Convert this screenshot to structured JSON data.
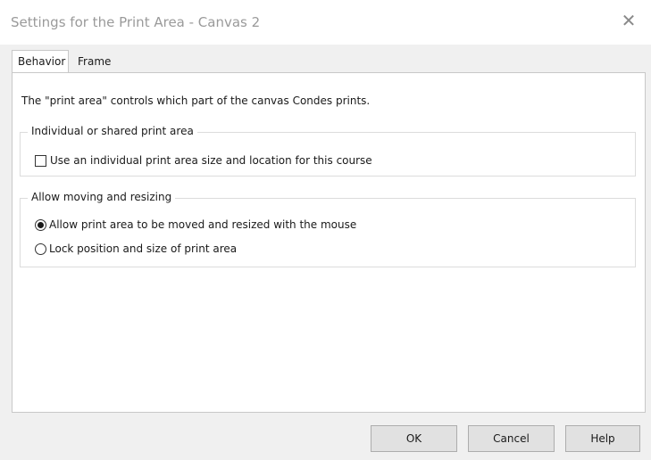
{
  "window": {
    "title": "Settings for the Print Area - Canvas 2",
    "close_glyph": "✕"
  },
  "tabs": [
    {
      "label": "Behavior",
      "active": true
    },
    {
      "label": "Frame",
      "active": false
    }
  ],
  "behavior": {
    "intro": "The \"print area\" controls which part of the canvas Condes prints.",
    "shared_group": {
      "legend": "Individual or shared print area",
      "checkbox_label": "Use an individual print area size and location for this course",
      "checked": false
    },
    "moving_group": {
      "legend": "Allow moving and resizing",
      "options": [
        {
          "label": "Allow print area to be moved and resized with the mouse",
          "selected": true
        },
        {
          "label": "Lock position and size of print area",
          "selected": false
        }
      ]
    }
  },
  "buttons": {
    "ok": "OK",
    "cancel": "Cancel",
    "help": "Help"
  }
}
